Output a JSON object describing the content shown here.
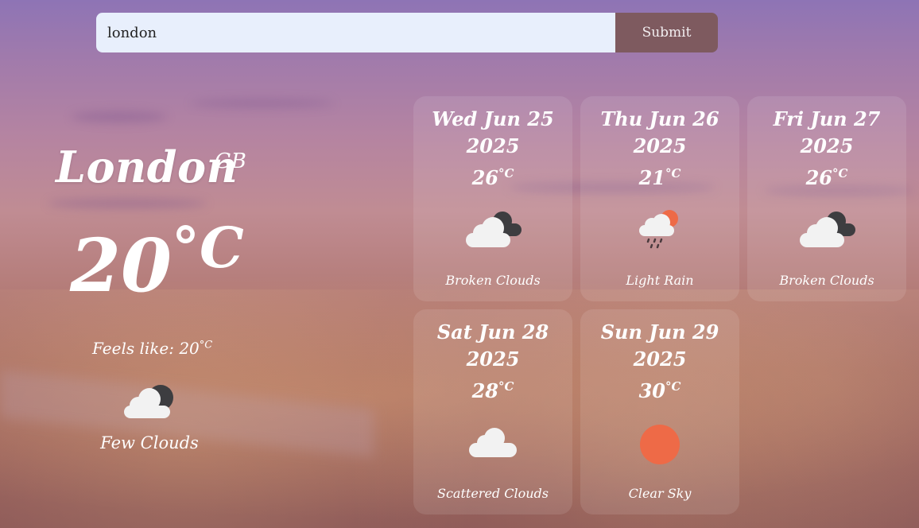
{
  "search": {
    "value": "london",
    "submit_label": "Submit"
  },
  "current": {
    "city": "London",
    "country": "GB",
    "temperature": "20",
    "unit": "°C",
    "feels_like_label": "Feels like: 20",
    "feels_like_unit": "°C",
    "description": "Few Clouds",
    "icon": "few-clouds-icon"
  },
  "forecast": [
    {
      "date": "Wed Jun 25",
      "year": "2025",
      "temp": "26",
      "unit": "°C",
      "description": "Broken Clouds",
      "icon": "broken-clouds-icon"
    },
    {
      "date": "Thu Jun 26",
      "year": "2025",
      "temp": "21",
      "unit": "°C",
      "description": "Light Rain",
      "icon": "light-rain-icon"
    },
    {
      "date": "Fri Jun 27",
      "year": "2025",
      "temp": "26",
      "unit": "°C",
      "description": "Broken Clouds",
      "icon": "broken-clouds-icon"
    },
    {
      "date": "Sat Jun 28",
      "year": "2025",
      "temp": "28",
      "unit": "°C",
      "description": "Scattered Clouds",
      "icon": "scattered-clouds-icon"
    },
    {
      "date": "Sun Jun 29",
      "year": "2025",
      "temp": "30",
      "unit": "°C",
      "description": "Clear Sky",
      "icon": "clear-sky-icon"
    }
  ],
  "colors": {
    "input_bg": "#e8effc",
    "submit_bg": "#7e5a5f",
    "sun": "#ee6a47",
    "cloud_light": "#f2f2f2",
    "cloud_dark": "#3d3d40"
  }
}
